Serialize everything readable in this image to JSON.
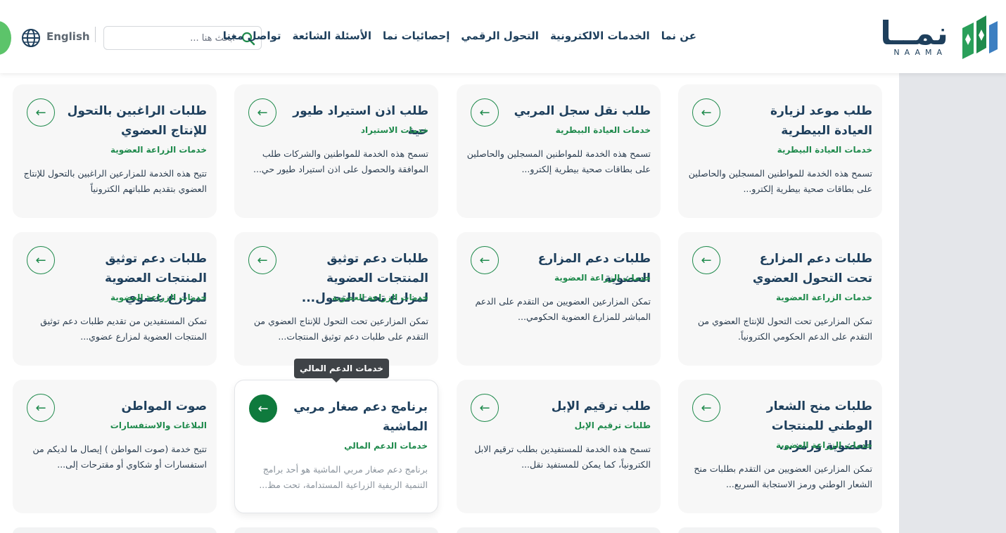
{
  "header": {
    "logo_text": "نمــا",
    "logo_latin": "NAAMA",
    "nav": [
      "عن نما",
      "الخدمات الالكترونية",
      "التحول الرقمي",
      "إحصائيات نما",
      "الأسئلة الشائعة",
      "تواصل معنا"
    ],
    "search_placeholder": "ابحث هنا ...",
    "language": "English",
    "icons": {
      "search": "search-icon",
      "language": "globe-icon"
    },
    "accent_color": "#1f8a4c",
    "brand_color": "#1e3f5c"
  },
  "cards": [
    {
      "title": "طلب موعد لزيارة العيادة البيطرية",
      "category": "خدمات العيادة البيطرية",
      "description": "تسمح هذه الخدمة للمواطنين المسجلين والحاصلين على بطاقات صحية بيطرية إلكترو..."
    },
    {
      "title": "طلب نقل سجل المربي",
      "category": "خدمات العيادة البيطرية",
      "description": "تسمح هذه الخدمة للمواطنين المسجلين والحاصلين على بطاقات صحية بيطرية إلكترو..."
    },
    {
      "title": "طلب اذن استيراد طيور حية",
      "category": "خدمات الاستيراد",
      "description": "تسمح هذه الخدمة للمواطنين والشركات طلب الموافقة والحصول على اذن استيراد طيور حي..."
    },
    {
      "title": "طلبات الراغبين بالتحول للإنتاج العضوي",
      "category": "خدمات الزراعة العضوية",
      "description": "تتيح هذه الخدمة للمزارعين الراغبين بالتحول للإنتاج العضوي بتقديم طلباتهم الكترونياً"
    },
    {
      "title": "طلبات دعم المزارع تحت التحول العضوي",
      "category": "خدمات الزراعة العضوية",
      "description": "تمكن المزارعين تحت التحول للإنتاج العضوي من التقدم على الدعم الحكومي الكترونياً."
    },
    {
      "title": "طلبات دعم المزارع العضوية",
      "category": "خدمات الزراعة العضوية",
      "description": "تمكن المزارعين العضويين من التقدم على الدعم المباشر للمزارع العضوية الحكومي..."
    },
    {
      "title": "طلبات دعم توثيق المنتجات العضوية لمزارع تحت التحول...",
      "category": "خدمات الزراعة العضوية",
      "description": "تمكن المزارعين تحت التحول للإنتاج العضوي من التقدم على طلبات دعم توثيق المنتجات..."
    },
    {
      "title": "طلبات دعم توثيق المنتجات العضوية لمزارع عضوي",
      "category": "خدمات الزراعة العضوية",
      "description": "تمكن المستفيدين من تقديم طلبات دعم توثيق المنتجات العضوية لمزارع عضوي..."
    },
    {
      "title": "طلبات منح الشعار الوطني للمنتجات العضوية ورمز...",
      "category": "خدمات الزراعة العضوية",
      "description": "تمكن المزارعين العضويين من التقدم بطلبات منح الشعار الوطني ورمز الاستجابة السريع..."
    },
    {
      "title": "طلب ترقيم الإبل",
      "category": "طلبات ترقيم الإبل",
      "description": "تسمح هذه الخدمة للمستفيدين بطلب ترقيم الابل الكترونياً، كما يمكن للمستفيد نقل..."
    },
    {
      "title": "برنامج دعم صغار مربي الماشية",
      "category": "خدمات الدعم المالي",
      "description": "برنامج دعم صغار مربي الماشية هو أحد برامج التنمية الريفية الزراعية المستدامة، تحت مظ..."
    },
    {
      "title": "صوت المواطن",
      "category": "البلاغات والاستفسارات",
      "description": "تتيح خدمة (صوت المواطن ) إيصال ما لديكم من استفسارات أو شكاوي أو مقترحات إلى..."
    }
  ],
  "tooltip": "خدمات الدعم المالي",
  "arrow_icon": "arrow-left-icon"
}
